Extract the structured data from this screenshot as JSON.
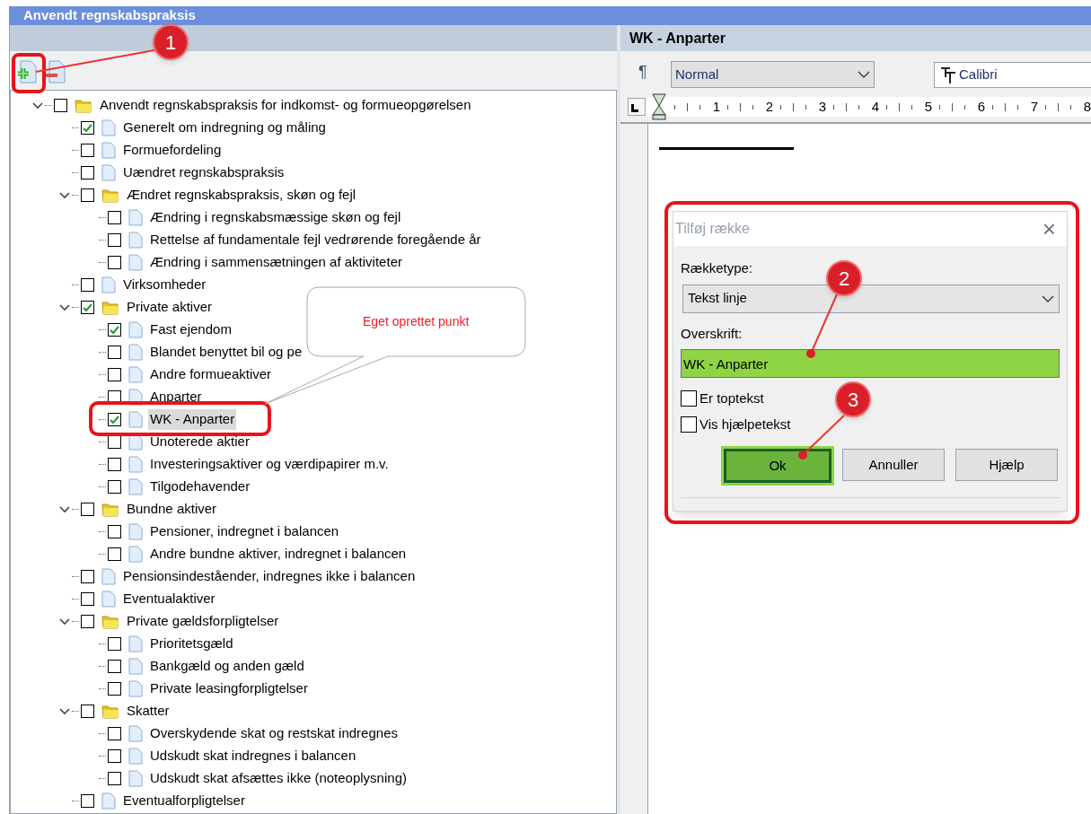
{
  "panel": {
    "title": "Anvendt regnskabspraksis"
  },
  "tree": [
    {
      "label": "Anvendt regnskabspraksis for indkomst- og formueopgørelsen",
      "kind": "folder",
      "checked": false,
      "expanded": true,
      "selected": false,
      "children": [
        {
          "label": "Generelt om indregning og måling",
          "kind": "document",
          "checked": true,
          "selected": false
        },
        {
          "label": "Formuefordeling",
          "kind": "document",
          "checked": false,
          "selected": false
        },
        {
          "label": "Uændret regnskabspraksis",
          "kind": "document",
          "checked": false,
          "selected": false
        },
        {
          "label": "Ændret regnskabspraksis, skøn og fejl",
          "kind": "folder",
          "checked": false,
          "expanded": true,
          "selected": false,
          "children": [
            {
              "label": "Ændring i regnskabsmæssige skøn og fejl",
              "kind": "document",
              "checked": false,
              "selected": false
            },
            {
              "label": "Rettelse af fundamentale fejl vedrørende foregående år",
              "kind": "document",
              "checked": false,
              "selected": false
            },
            {
              "label": "Ændring i sammensætningen af aktiviteter",
              "kind": "document",
              "checked": false,
              "selected": false
            }
          ]
        },
        {
          "label": "Virksomheder",
          "kind": "document",
          "checked": false,
          "selected": false
        },
        {
          "label": "Private aktiver",
          "kind": "folder",
          "checked": true,
          "expanded": true,
          "selected": false,
          "children": [
            {
              "label": "Fast ejendom",
              "kind": "document",
              "checked": true,
              "selected": false
            },
            {
              "label": "Blandet benyttet bil og pe",
              "kind": "document",
              "checked": false,
              "selected": false
            },
            {
              "label": "Andre formueaktiver",
              "kind": "document",
              "checked": false,
              "selected": false
            },
            {
              "label": "Anparter",
              "kind": "document",
              "checked": false,
              "selected": false
            },
            {
              "label": "WK - Anparter",
              "kind": "document",
              "checked": true,
              "selected": true
            },
            {
              "label": "Unoterede aktier",
              "kind": "document",
              "checked": false,
              "selected": false
            },
            {
              "label": "Investeringsaktiver og værdipapirer m.v.",
              "kind": "document",
              "checked": false,
              "selected": false
            },
            {
              "label": "Tilgodehavender",
              "kind": "document",
              "checked": false,
              "selected": false
            }
          ]
        },
        {
          "label": "Bundne aktiver",
          "kind": "folder",
          "checked": false,
          "expanded": true,
          "selected": false,
          "children": [
            {
              "label": "Pensioner, indregnet i balancen",
              "kind": "document",
              "checked": false,
              "selected": false
            },
            {
              "label": "Andre bundne aktiver, indregnet i balancen",
              "kind": "document",
              "checked": false,
              "selected": false
            }
          ]
        },
        {
          "label": "Pensionsindeståender, indregnes ikke i balancen",
          "kind": "document",
          "checked": false,
          "selected": false
        },
        {
          "label": "Eventualaktiver",
          "kind": "document",
          "checked": false,
          "selected": false
        },
        {
          "label": "Private gældsforpligtelser",
          "kind": "folder",
          "checked": false,
          "expanded": true,
          "selected": false,
          "children": [
            {
              "label": "Prioritetsgæld",
              "kind": "document",
              "checked": false,
              "selected": false
            },
            {
              "label": "Bankgæld og anden gæld",
              "kind": "document",
              "checked": false,
              "selected": false
            },
            {
              "label": "Private leasingforpligtelser",
              "kind": "document",
              "checked": false,
              "selected": false
            }
          ]
        },
        {
          "label": "Skatter",
          "kind": "folder",
          "checked": false,
          "expanded": true,
          "selected": false,
          "children": [
            {
              "label": "Overskydende skat og restskat indregnes",
              "kind": "document",
              "checked": false,
              "selected": false
            },
            {
              "label": "Udskudt skat indregnes i balancen",
              "kind": "document",
              "checked": false,
              "selected": false
            },
            {
              "label": "Udskudt skat afsættes ikke (noteoplysning)",
              "kind": "document",
              "checked": false,
              "selected": false
            }
          ]
        },
        {
          "label": "Eventualforpligtelser",
          "kind": "document",
          "checked": false,
          "selected": false
        }
      ]
    }
  ],
  "editor": {
    "title": "WK - Anparter",
    "paragraph_mark": "¶",
    "style": "Normal",
    "font": "Calibri",
    "ruler": [
      "1",
      "2",
      "3",
      "4",
      "5",
      "6",
      "7",
      "8"
    ]
  },
  "dialog": {
    "title": "Tilføj række",
    "close": "×",
    "row_type_label": "Rækketype:",
    "row_type": "Tekst linje",
    "heading_label": "Overskrift:",
    "heading": "WK - Anparter",
    "options": [
      {
        "label": "Er toptekst",
        "checked": false
      },
      {
        "label": "Vis hjælpetekst",
        "checked": false
      }
    ],
    "buttons": [
      {
        "label": "Ok",
        "highlighted": true
      },
      {
        "label": "Annuller",
        "highlighted": false
      },
      {
        "label": "Hjælp",
        "highlighted": false
      }
    ]
  },
  "annotations": {
    "steps": [
      "1",
      "2",
      "3"
    ],
    "callout": "Eget oprettet punkt"
  }
}
